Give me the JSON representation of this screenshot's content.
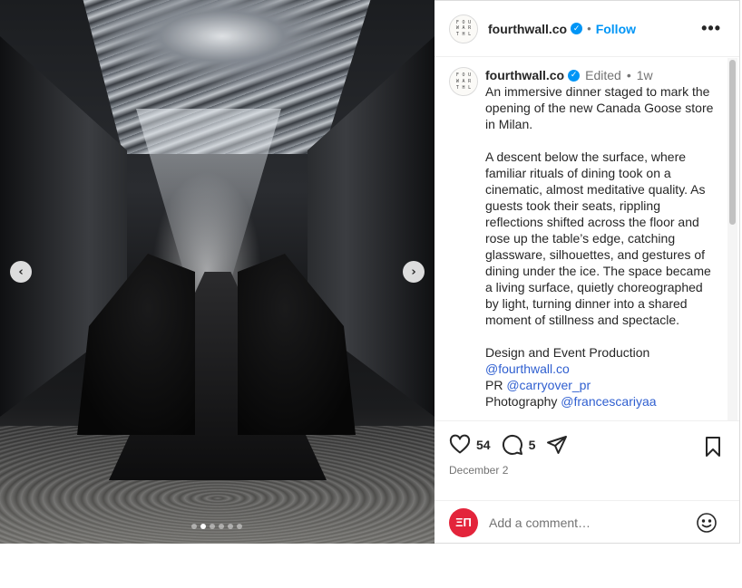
{
  "media": {
    "prev_glyph": "‹",
    "next_glyph": "›",
    "slide_count": 6,
    "active_slide": 2
  },
  "header": {
    "avatar_letters": [
      "F",
      "O",
      "U",
      "W",
      "A",
      "R",
      "T",
      "H",
      "L"
    ],
    "username": "fourthwall.co",
    "verified_glyph": "✓",
    "separator": "•",
    "follow_label": "Follow",
    "more_glyph": "•••"
  },
  "caption": {
    "username": "fourthwall.co",
    "verified_glyph": "✓",
    "edited_label": "Edited",
    "separator": "•",
    "time": "1w",
    "paragraph_1": "An immersive dinner staged to mark the opening of the new Canada Goose store in Milan.",
    "paragraph_2": "A descent below the surface, where familiar rituals of dining took on a cinematic, almost meditative quality. As guests took their seats, rippling reflections shifted across the floor and rose up the table’s edge, catching glassware, silhouettes, and gestures of dining under the ice. The space became a living surface, quietly choreographed by light, turning dinner into a shared moment of stillness and spectacle.",
    "credits": [
      {
        "role": "Design and Event Production",
        "handle": "@fourthwall.co",
        "inline": false
      },
      {
        "role": "PR",
        "handle": "@carryover_pr",
        "inline": true
      },
      {
        "role": "Photography",
        "handle": "@francescariyaa",
        "inline": true
      }
    ]
  },
  "actions": {
    "like_icon": "heart-icon",
    "like_count": "54",
    "comment_icon": "comment-icon",
    "comment_count": "5",
    "share_icon": "share-icon",
    "save_icon": "bookmark-icon",
    "date": "December 2"
  },
  "add_comment": {
    "avatar_text": "ΞΠ",
    "placeholder": "Add a comment…",
    "emoji_icon": "smiley-icon"
  },
  "colors": {
    "accent": "#0095f6",
    "muted": "#737373",
    "text": "#262626",
    "mention": "#2f5fd0"
  }
}
